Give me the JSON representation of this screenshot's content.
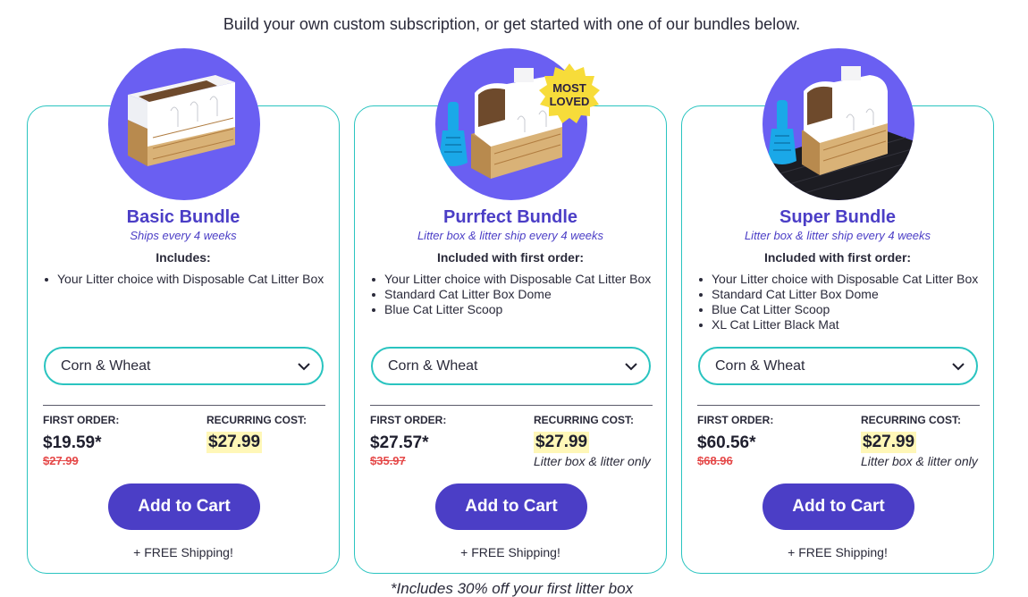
{
  "intro": "Build your own custom subscription, or get started with one of our bundles below.",
  "colors": {
    "brand_purple": "#4b3ec6",
    "circle_purple": "#6a5ff2",
    "teal_border": "#2ac4c0",
    "highlight_yellow": "#fff7b8",
    "strike_red": "#e54848",
    "badge_yellow": "#f7dc3a"
  },
  "bundles": [
    {
      "name": "Basic Bundle",
      "ships": "Ships every 4 weeks",
      "includes_title": "Includes:",
      "items": [
        "Your Litter choice with Disposable Cat Litter Box"
      ],
      "litter_choice": "Corn & Wheat",
      "first_order_label": "FIRST ORDER:",
      "recurring_label": "RECURRING COST:",
      "first_price": "$19.59*",
      "old_price": "$27.99",
      "recurring_price": "$27.99",
      "recurring_note": "",
      "add_to_cart": "Add to Cart",
      "shipping": "+ FREE Shipping!",
      "image_icon": "litter-box-icon"
    },
    {
      "name": "Purrfect Bundle",
      "ships": "Litter box & litter ship every 4 weeks",
      "includes_title": "Included with first order:",
      "items": [
        "Your Litter choice with Disposable Cat Litter Box",
        "Standard Cat Litter Box Dome",
        "Blue Cat Litter Scoop"
      ],
      "litter_choice": "Corn & Wheat",
      "first_order_label": "FIRST ORDER:",
      "recurring_label": "RECURRING COST:",
      "first_price": "$27.57*",
      "old_price": "$35.97",
      "recurring_price": "$27.99",
      "recurring_note": "Litter box & litter only",
      "add_to_cart": "Add to Cart",
      "shipping": "+ FREE Shipping!",
      "badge": "MOST LOVED",
      "image_icon": "litter-box-dome-scoop-icon"
    },
    {
      "name": "Super Bundle",
      "ships": "Litter box & litter ship every 4 weeks",
      "includes_title": "Included with first order:",
      "items": [
        "Your Litter choice with Disposable Cat Litter Box",
        "Standard Cat Litter Box Dome",
        "Blue Cat Litter Scoop",
        "XL Cat Litter Black Mat"
      ],
      "litter_choice": "Corn & Wheat",
      "first_order_label": "FIRST ORDER:",
      "recurring_label": "RECURRING COST:",
      "first_price": "$60.56*",
      "old_price": "$68.96",
      "recurring_price": "$27.99",
      "recurring_note": "Litter box & litter only",
      "add_to_cart": "Add to Cart",
      "shipping": "+ FREE Shipping!",
      "image_icon": "litter-box-dome-scoop-mat-icon"
    }
  ],
  "footnote": "*Includes 30% off your first litter box"
}
